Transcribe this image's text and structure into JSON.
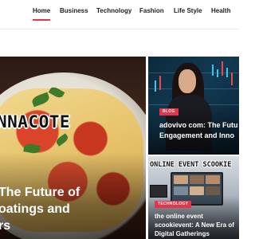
{
  "nav": {
    "items": [
      {
        "label": "Home",
        "active": true
      },
      {
        "label": "Business"
      },
      {
        "label": "Technology"
      },
      {
        "label": "Fashion"
      },
      {
        "label": "Life Style"
      },
      {
        "label": "Health"
      }
    ]
  },
  "hero": {
    "brand": "NNACOTE",
    "title_lines": [
      "The Future of",
      "oatings and",
      "rs"
    ]
  },
  "cards": [
    {
      "badge": "BLOG",
      "title_lines": [
        "adovivo com: The Futu",
        "Engagement and Inno"
      ]
    },
    {
      "banner": "ONLINE EVENT SCOOKIE",
      "badge": "TECHNOLOGY",
      "title_lines": [
        "the online event",
        "scookievent: A New Era of",
        "Digital Gatherings"
      ]
    }
  ],
  "colors": {
    "accent": "#e8344a",
    "nav_text": "#222222"
  }
}
